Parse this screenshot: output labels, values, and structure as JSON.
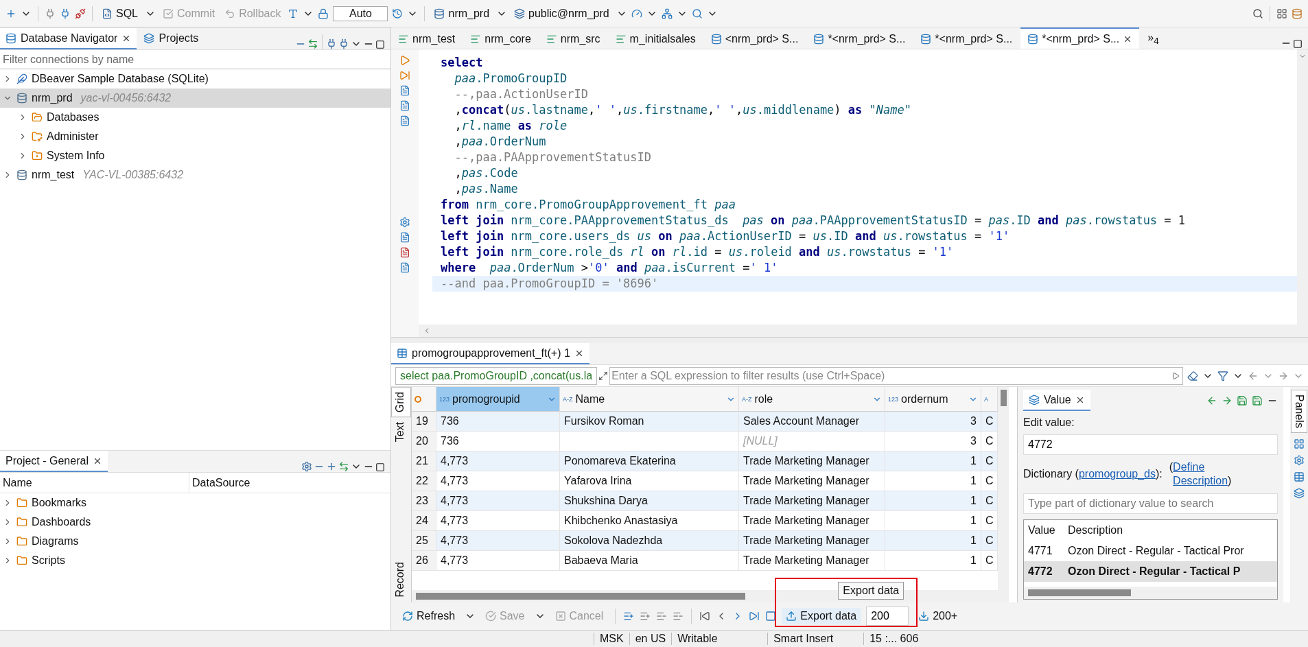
{
  "toolbar": {
    "items": [
      {
        "kind": "sql",
        "label": "SQL",
        "disabled": false
      },
      {
        "kind": "commit",
        "label": "Commit",
        "disabled": true
      },
      {
        "kind": "rollback",
        "label": "Rollback",
        "disabled": true
      },
      {
        "kind": "mode",
        "label": "Auto",
        "disabled": false
      },
      {
        "kind": "connection",
        "label": "nrm_prd",
        "disabled": false
      },
      {
        "kind": "schema",
        "label": "public@nrm_prd",
        "disabled": false
      }
    ]
  },
  "navigator": {
    "tabs": [
      {
        "label": "Database Navigator",
        "selected": true
      },
      {
        "label": "Projects",
        "selected": false
      }
    ],
    "filter_placeholder": "Filter connections by name",
    "tree": [
      {
        "label": "DBeaver Sample Database (SQLite)",
        "kind": "sqlite",
        "expanded": false,
        "selected": false
      },
      {
        "label": "nrm_prd",
        "detail": "yac-vl-00456:6432",
        "kind": "postgres",
        "expanded": true,
        "selected": true,
        "children": [
          {
            "label": "Databases",
            "kind": "databases",
            "expanded": false,
            "selected": false
          },
          {
            "label": "Administer",
            "kind": "admin",
            "expanded": false,
            "selected": false
          },
          {
            "label": "System Info",
            "kind": "info",
            "expanded": false,
            "selected": false
          }
        ]
      },
      {
        "label": "nrm_test",
        "detail": "YAC-VL-00385:6432",
        "kind": "postgres",
        "expanded": false,
        "selected": false
      }
    ]
  },
  "project": {
    "title": "Project - General",
    "columns": [
      "Name",
      "DataSource"
    ],
    "items": [
      "Bookmarks",
      "Dashboards",
      "Diagrams",
      "Scripts"
    ]
  },
  "editor": {
    "tabs": [
      {
        "label": "nrm_test",
        "kind": "script",
        "selected": false
      },
      {
        "label": "nrm_core",
        "kind": "script",
        "selected": false
      },
      {
        "label": "nrm_src",
        "kind": "script",
        "selected": false
      },
      {
        "label": "m_initialsales",
        "kind": "script",
        "selected": false
      },
      {
        "label": "<nrm_prd> S...",
        "kind": "console",
        "selected": false
      },
      {
        "label": "*<nrm_prd> S...",
        "kind": "console",
        "selected": false
      },
      {
        "label": "*<nrm_prd> S...",
        "kind": "console",
        "selected": false
      },
      {
        "label": "*<nrm_prd> S...",
        "kind": "console",
        "selected": true
      }
    ],
    "overflow": "»$_{4}$",
    "lines": [
      {
        "current": false,
        "tokens": [
          {
            "kind": "kw",
            "text": "select"
          }
        ]
      },
      {
        "current": false,
        "tokens": [
          {
            "kind": "alias",
            "text": "  paa"
          },
          {
            "kind": "ident",
            "text": ".PromoGroupID"
          }
        ]
      },
      {
        "current": false,
        "tokens": [
          {
            "kind": "comment",
            "text": "  --,paa.ActionUserID"
          }
        ]
      },
      {
        "current": false,
        "tokens": [
          {
            "kind": "plain",
            "text": "  ,"
          },
          {
            "kind": "kw",
            "text": "concat"
          },
          {
            "kind": "plain",
            "text": "("
          },
          {
            "kind": "alias",
            "text": "us"
          },
          {
            "kind": "ident",
            "text": ".lastname"
          },
          {
            "kind": "plain",
            "text": ","
          },
          {
            "kind": "str",
            "text": "' '"
          },
          {
            "kind": "plain",
            "text": ","
          },
          {
            "kind": "alias",
            "text": "us"
          },
          {
            "kind": "ident",
            "text": ".firstname"
          },
          {
            "kind": "plain",
            "text": ","
          },
          {
            "kind": "str",
            "text": "' '"
          },
          {
            "kind": "plain",
            "text": ","
          },
          {
            "kind": "alias",
            "text": "us"
          },
          {
            "kind": "ident",
            "text": ".middlename"
          },
          {
            "kind": "plain",
            "text": ") "
          },
          {
            "kind": "kw",
            "text": "as "
          },
          {
            "kind": "quoted",
            "text": "\"Name\""
          }
        ]
      },
      {
        "current": false,
        "tokens": [
          {
            "kind": "plain",
            "text": "  ,"
          },
          {
            "kind": "alias",
            "text": "rl"
          },
          {
            "kind": "ident",
            "text": ".name "
          },
          {
            "kind": "kw",
            "text": "as "
          },
          {
            "kind": "quoted",
            "text": "role"
          }
        ]
      },
      {
        "current": false,
        "tokens": [
          {
            "kind": "plain",
            "text": "  ,"
          },
          {
            "kind": "alias",
            "text": "paa"
          },
          {
            "kind": "ident",
            "text": ".OrderNum"
          }
        ]
      },
      {
        "current": false,
        "tokens": [
          {
            "kind": "comment",
            "text": "  --,paa.PAApprovementStatusID"
          }
        ]
      },
      {
        "current": false,
        "tokens": [
          {
            "kind": "plain",
            "text": "  ,"
          },
          {
            "kind": "alias",
            "text": "pas"
          },
          {
            "kind": "ident",
            "text": ".Code"
          }
        ]
      },
      {
        "current": false,
        "tokens": [
          {
            "kind": "plain",
            "text": "  ,"
          },
          {
            "kind": "alias",
            "text": "pas"
          },
          {
            "kind": "ident",
            "text": ".Name"
          }
        ]
      },
      {
        "current": false,
        "tokens": [
          {
            "kind": "kw",
            "text": "from"
          },
          {
            "kind": "ident",
            "text": " nrm_core.PromoGroupApprovement_ft "
          },
          {
            "kind": "alias",
            "text": "paa"
          }
        ]
      },
      {
        "current": false,
        "tokens": [
          {
            "kind": "kw",
            "text": "left join"
          },
          {
            "kind": "ident",
            "text": " nrm_core.PAApprovementStatus_ds  "
          },
          {
            "kind": "alias",
            "text": "pas "
          },
          {
            "kind": "kw",
            "text": "on "
          },
          {
            "kind": "alias",
            "text": "paa"
          },
          {
            "kind": "ident",
            "text": ".PAApprovementStatusID"
          },
          {
            "kind": "plain",
            "text": " = "
          },
          {
            "kind": "alias",
            "text": "pas"
          },
          {
            "kind": "ident",
            "text": ".ID "
          },
          {
            "kind": "kw",
            "text": "and "
          },
          {
            "kind": "alias",
            "text": "pas"
          },
          {
            "kind": "ident",
            "text": ".rowstatus"
          },
          {
            "kind": "plain",
            "text": " = 1"
          }
        ]
      },
      {
        "current": false,
        "tokens": [
          {
            "kind": "kw",
            "text": "left join"
          },
          {
            "kind": "ident",
            "text": " nrm_core.users_ds "
          },
          {
            "kind": "alias",
            "text": "us "
          },
          {
            "kind": "kw",
            "text": "on "
          },
          {
            "kind": "alias",
            "text": "paa"
          },
          {
            "kind": "ident",
            "text": ".ActionUserID"
          },
          {
            "kind": "plain",
            "text": " = "
          },
          {
            "kind": "alias",
            "text": "us"
          },
          {
            "kind": "ident",
            "text": ".ID "
          },
          {
            "kind": "kw",
            "text": "and "
          },
          {
            "kind": "alias",
            "text": "us"
          },
          {
            "kind": "ident",
            "text": ".rowstatus"
          },
          {
            "kind": "plain",
            "text": " = "
          },
          {
            "kind": "str",
            "text": "'1'"
          }
        ]
      },
      {
        "current": false,
        "tokens": [
          {
            "kind": "kw",
            "text": "left join"
          },
          {
            "kind": "ident",
            "text": " nrm_core.role_ds "
          },
          {
            "kind": "alias",
            "text": "rl "
          },
          {
            "kind": "kw",
            "text": "on "
          },
          {
            "kind": "alias",
            "text": "rl"
          },
          {
            "kind": "ident",
            "text": ".id"
          },
          {
            "kind": "plain",
            "text": " = "
          },
          {
            "kind": "alias",
            "text": "us"
          },
          {
            "kind": "ident",
            "text": ".roleid "
          },
          {
            "kind": "kw",
            "text": "and "
          },
          {
            "kind": "alias",
            "text": "us"
          },
          {
            "kind": "ident",
            "text": ".rowstatus"
          },
          {
            "kind": "plain",
            "text": " = "
          },
          {
            "kind": "str",
            "text": "'1'"
          }
        ]
      },
      {
        "current": false,
        "tokens": [
          {
            "kind": "kw",
            "text": "where  "
          },
          {
            "kind": "alias",
            "text": "paa"
          },
          {
            "kind": "ident",
            "text": ".OrderNum"
          },
          {
            "kind": "plain",
            "text": " >"
          },
          {
            "kind": "str",
            "text": "'0' "
          },
          {
            "kind": "kw",
            "text": "and "
          },
          {
            "kind": "alias",
            "text": "paa"
          },
          {
            "kind": "ident",
            "text": ".isCurrent"
          },
          {
            "kind": "plain",
            "text": " ="
          },
          {
            "kind": "str",
            "text": "' 1'"
          }
        ]
      },
      {
        "current": true,
        "tokens": [
          {
            "kind": "comment",
            "text": "--and paa.PromoGroupID = '8696'"
          }
        ]
      }
    ]
  },
  "results": {
    "tab": "promogroupapprovement_ft(+) 1",
    "query": "select paa.PromoGroupID ,concat(us.la",
    "filter_placeholder": "Enter a SQL expression to filter results (use Ctrl+Space)",
    "view_tabs": [
      {
        "label": "Grid",
        "selected": true
      },
      {
        "label": "Text",
        "selected": false
      },
      {
        "label": "Record",
        "selected": false
      }
    ],
    "columns": [
      {
        "type": "123",
        "name": "promogroupid",
        "selected": true,
        "kind": "text"
      },
      {
        "type": "A-Z",
        "name": "Name",
        "selected": false,
        "kind": "text"
      },
      {
        "type": "A-Z",
        "name": "role",
        "selected": false,
        "kind": "text"
      },
      {
        "type": "123",
        "name": "ordernum",
        "selected": false,
        "kind": "number"
      },
      {
        "type": "A",
        "selected": false,
        "kind": "text"
      }
    ],
    "rows": [
      {
        "num": "19",
        "cells": [
          "736",
          "Fursikov Roman",
          "Sales Account Manager",
          "3",
          "C"
        ],
        "nulls": [
          false,
          false,
          false,
          false,
          false
        ]
      },
      {
        "num": "20",
        "cells": [
          "736",
          "",
          "[NULL]",
          "3",
          "C"
        ],
        "nulls": [
          false,
          false,
          true,
          false,
          false
        ]
      },
      {
        "num": "21",
        "cells": [
          "4,773",
          "Ponomareva Ekaterina",
          "Trade Marketing Manager",
          "1",
          "C"
        ],
        "nulls": [
          false,
          false,
          false,
          false,
          false
        ]
      },
      {
        "num": "22",
        "cells": [
          "4,773",
          "Yafarova Irina",
          "Trade Marketing Manager",
          "1",
          "C"
        ],
        "nulls": [
          false,
          false,
          false,
          false,
          false
        ]
      },
      {
        "num": "23",
        "cells": [
          "4,773",
          "Shukshina Darya",
          "Trade Marketing Manager",
          "1",
          "C"
        ],
        "nulls": [
          false,
          false,
          false,
          false,
          false
        ]
      },
      {
        "num": "24",
        "cells": [
          "4,773",
          "Khibchenko Anastasiya",
          "Trade Marketing Manager",
          "1",
          "C"
        ],
        "nulls": [
          false,
          false,
          false,
          false,
          false
        ]
      },
      {
        "num": "25",
        "cells": [
          "4,773",
          "Sokolova Nadezhda",
          "Trade Marketing Manager",
          "1",
          "C"
        ],
        "nulls": [
          false,
          false,
          false,
          false,
          false
        ]
      },
      {
        "num": "26",
        "cells": [
          "4,773",
          "Babaeva Maria",
          "Trade Marketing Manager",
          "1",
          "C"
        ],
        "nulls": [
          false,
          false,
          false,
          false,
          false
        ]
      }
    ],
    "value_panel": {
      "tab": "Value",
      "edit_label": "Edit value:",
      "value": "4772",
      "dict_label": "Dictionary",
      "dict_open": "(",
      "dict_link": "promogroup_ds",
      "dict_close": "):",
      "define_open": "(",
      "define_link": "Define Description",
      "define_close": ")",
      "search_placeholder": "Type part of dictionary value to search",
      "columns": [
        "Value",
        "Description"
      ],
      "rows": [
        {
          "value": "4771",
          "description": "Ozon Direct - Regular - Tactical Pror",
          "selected": false
        },
        {
          "value": "4772",
          "description": "Ozon Direct - Regular - Tactical P",
          "selected": true
        }
      ]
    },
    "panels_label": "Panels",
    "bottom_bar": {
      "items": [
        {
          "kind": "refresh",
          "label": "Refresh",
          "disabled": false
        },
        {
          "kind": "save",
          "label": "Save",
          "disabled": true
        },
        {
          "kind": "cancel",
          "label": "Cancel",
          "disabled": true
        },
        {
          "kind": "export",
          "label": "Export data",
          "disabled": false
        },
        {
          "kind": "fetch_size",
          "label": "200",
          "disabled": false
        },
        {
          "kind": "fetch_all",
          "label": "200+",
          "disabled": false
        }
      ],
      "tooltip": "Export data",
      "export_highlighted": true
    }
  },
  "status_bar": [
    "MSK",
    "en US",
    "Writable",
    "Smart Insert",
    "15 :... 606"
  ]
}
